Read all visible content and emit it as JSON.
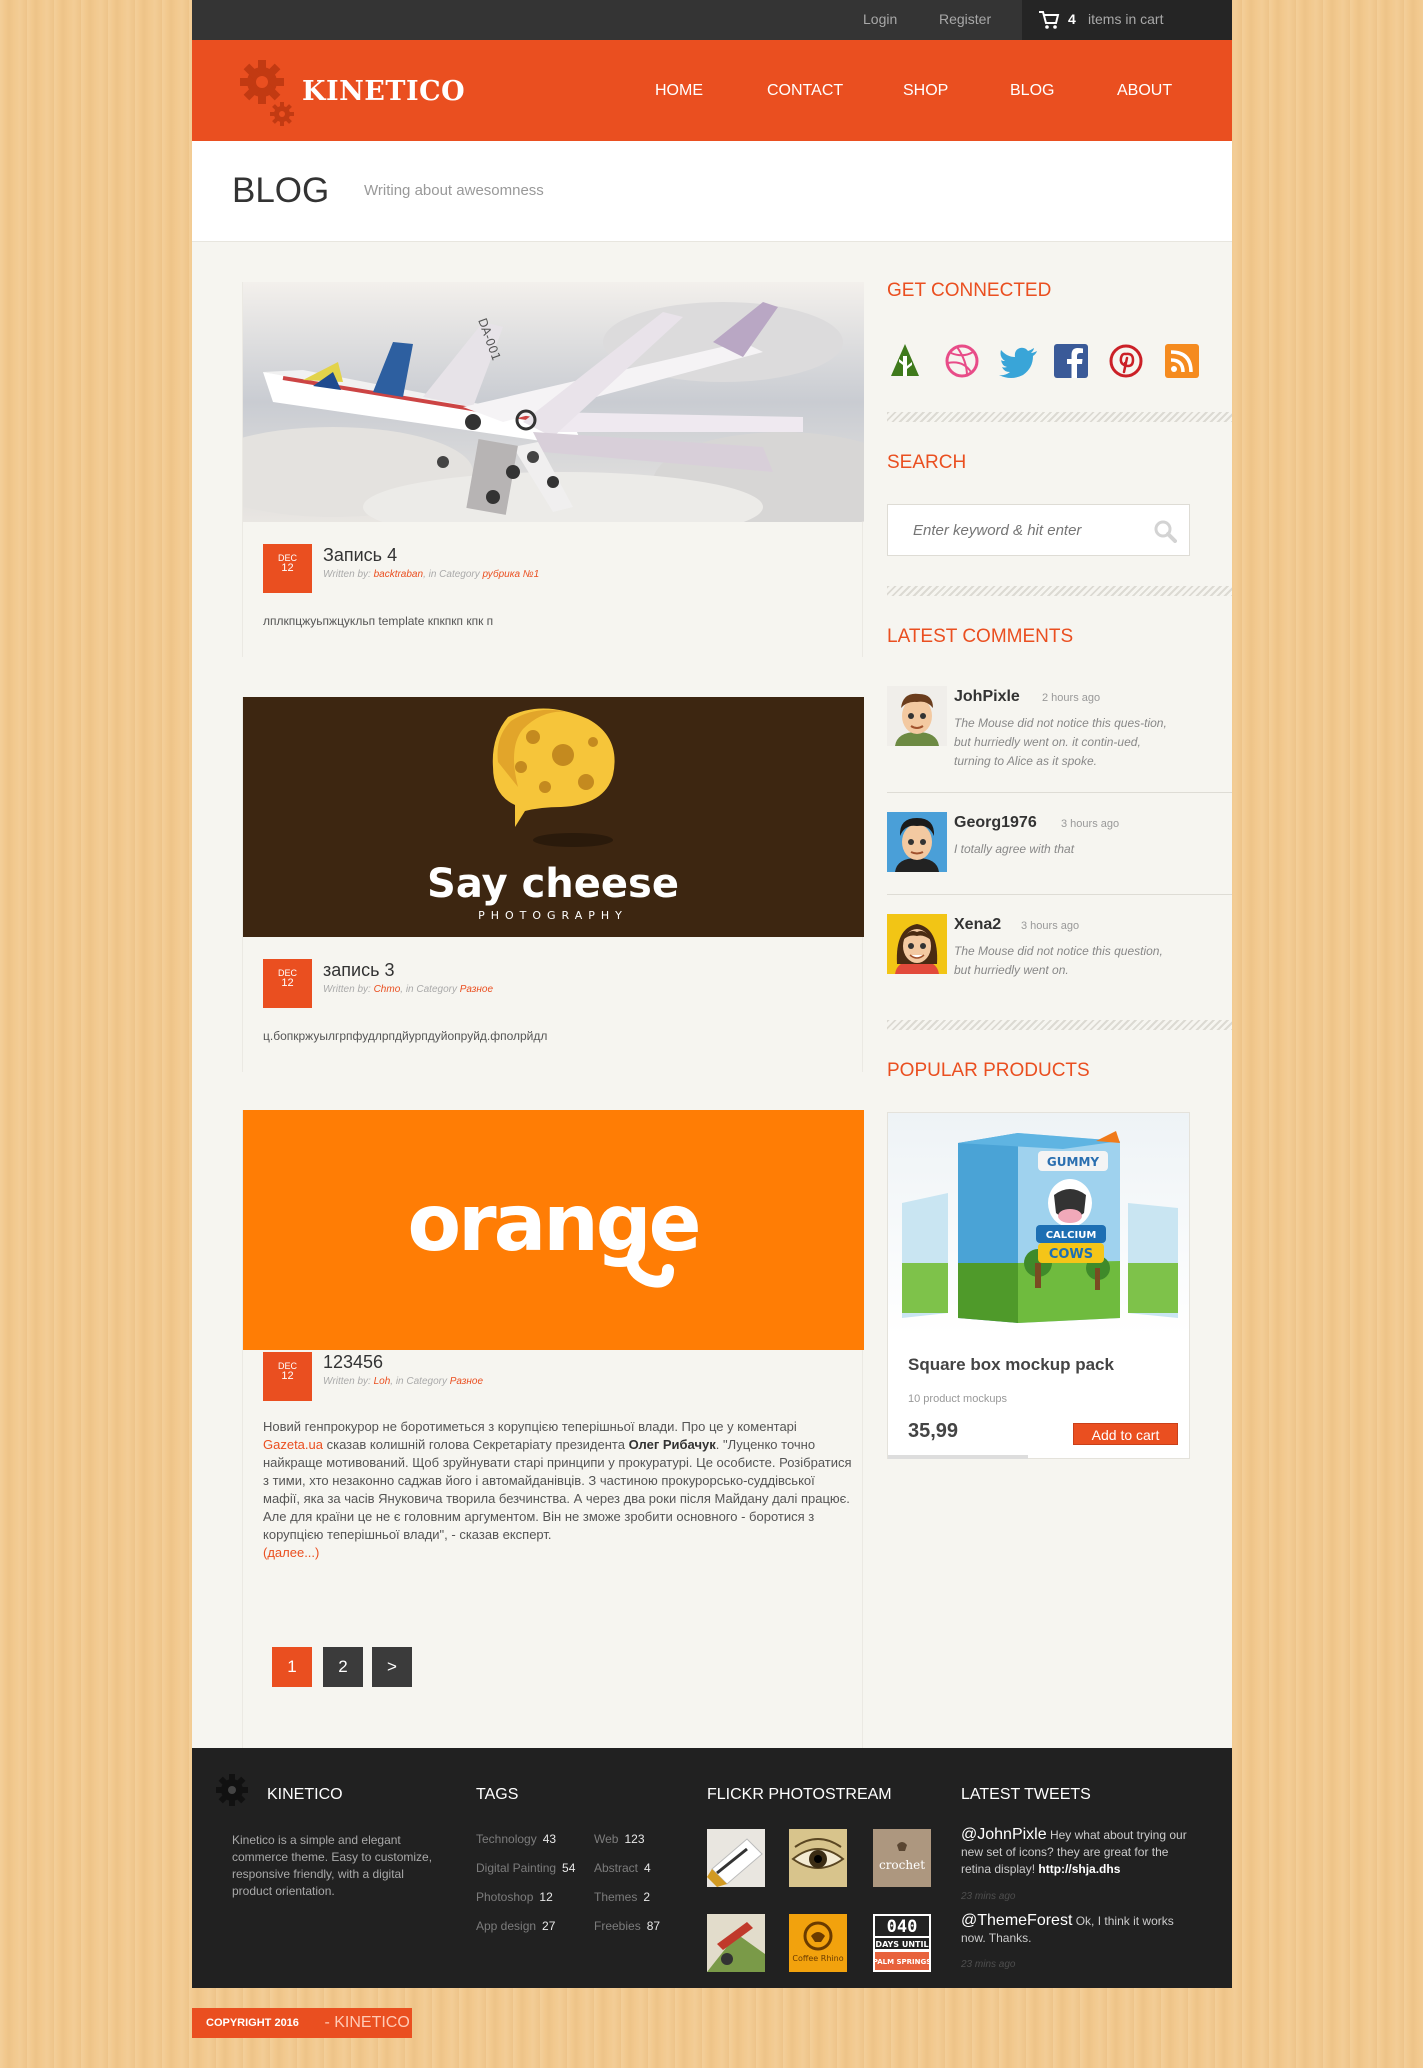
{
  "topbar": {
    "login": "Login",
    "register": "Register",
    "cart_count": "4",
    "cart_text": "items in cart"
  },
  "brand": {
    "name": "KINETICO",
    "accent": "#ea4f20"
  },
  "nav": {
    "home": "HOME",
    "contact": "CONTACT",
    "shop": "SHOP",
    "blog": "BLOG",
    "about": "ABOUT"
  },
  "page": {
    "title": "BLOG",
    "subtitle": "Writing about awesomness"
  },
  "posts": [
    {
      "month": "DEC",
      "day": "12",
      "title": "Запись 4",
      "written_by": "Written by:",
      "author": "backtraban",
      "in_category": ", in Category",
      "category": "рубрика №1",
      "excerpt": "лплкпцжуьпжцукльп template кпкпкп кпк п"
    },
    {
      "month": "DEC",
      "day": "12",
      "title": "запись 3",
      "written_by": "Written by:",
      "author": "Chmo",
      "in_category": ", in Category",
      "category": "Разное",
      "excerpt": "ц.бопкржуылгрпфудлрпдйурпдуйопруйд.фполрйдл",
      "image_title": "Say cheese",
      "image_sub": "PHOTOGRAPHY"
    },
    {
      "month": "DEC",
      "day": "12",
      "title": "123456",
      "written_by": "Written by:",
      "author": "Loh",
      "in_category": ", in Category",
      "category": "Разное",
      "image_logo": "orange",
      "body_1": "Новий генпрокурор не боротиметься з корупцією теперішньої влади. Про це у коментарі ",
      "body_link": "Gazeta.ua",
      "body_2": " сказав колишній голова Секретаріату президента ",
      "body_bold": "Олег Рибачук",
      "body_3": ". \"Луценко точно найкраще мотивований. Щоб зруйнувати старі принципи у прокуратурі. Це особисте. Розібратися з тими, хто незаконно саджав його і автомайданівців. З частиною прокурорсько-суддівської мафії, яка за часів Януковича творила безчинства. А через два роки після Майдану далі працює. Але для країни це не є головним аргументом. Він не зможе зробити основного - боротися з корупцією теперішньої влади\", - сказав експерт.",
      "more": "(далее...)"
    }
  ],
  "pagination": [
    "1",
    "2",
    ">"
  ],
  "sidebar": {
    "connected_title": "GET CONNECTED",
    "social_icons": [
      "forrst-icon",
      "dribbble-icon",
      "twitter-icon",
      "facebook-icon",
      "pinterest-icon",
      "rss-icon"
    ],
    "search_title": "SEARCH",
    "search_placeholder": "Enter keyword & hit enter",
    "comments_title": "LATEST COMMENTS",
    "comments": [
      {
        "name": "JohPixle",
        "time": "2 hours ago",
        "text": "The Mouse did not notice this ques-tion, but hurriedly went on. it contin-ued, turning to Alice as it spoke."
      },
      {
        "name": "Georg1976",
        "time": "3 hours ago",
        "text": "I totally agree with that"
      },
      {
        "name": "Xena2",
        "time": "3 hours ago",
        "text": "The Mouse did not notice this question, but hurriedly went on."
      }
    ],
    "products_title": "POPULAR PRODUCTS",
    "product": {
      "name": "Square box mockup pack",
      "desc": "10 product mockups",
      "price": "35,99",
      "button": "Add to cart",
      "box_brand": "GUMMY",
      "box_title": "CALCIUM",
      "box_title2": "COWS"
    }
  },
  "footer": {
    "brand": "KINETICO",
    "about": "Kinetico is a simple and elegant commerce theme. Easy to customize, responsive friendly, with a digital product orientation.",
    "tags_title": "TAGS",
    "tags": [
      {
        "name": "Technology",
        "count": "43"
      },
      {
        "name": "Web",
        "count": "123"
      },
      {
        "name": "Digital Painting",
        "count": "54"
      },
      {
        "name": "Abstract",
        "count": "4"
      },
      {
        "name": "Photoshop",
        "count": "12"
      },
      {
        "name": "Themes",
        "count": "2"
      },
      {
        "name": "App design",
        "count": "27"
      },
      {
        "name": "Freebies",
        "count": "87"
      }
    ],
    "flickr_title": "FLICKR PHOTOSTREAM",
    "flickr_labels": {
      "crochet": "crochet",
      "coffee": "Coffee Rhino",
      "days_num": "040",
      "days_txt": "DAYS UNTIL",
      "palm": "PALM SPRINGS"
    },
    "tweets_title": "LATEST TWEETS",
    "tweets": [
      {
        "handle": "@JohnPixle",
        "text": " Hey what about trying our new set of icons? they are great for the retina display! ",
        "link": "http://shja.dhs",
        "time": "23 mins ago"
      },
      {
        "handle": "@ThemeForest",
        "text": " Ok, I think it works now. Thanks.",
        "link": "",
        "time": "23 mins ago"
      }
    ]
  },
  "copyright": {
    "text": "COPYRIGHT 2016",
    "sep": " - ",
    "brand": "KINETICO"
  }
}
